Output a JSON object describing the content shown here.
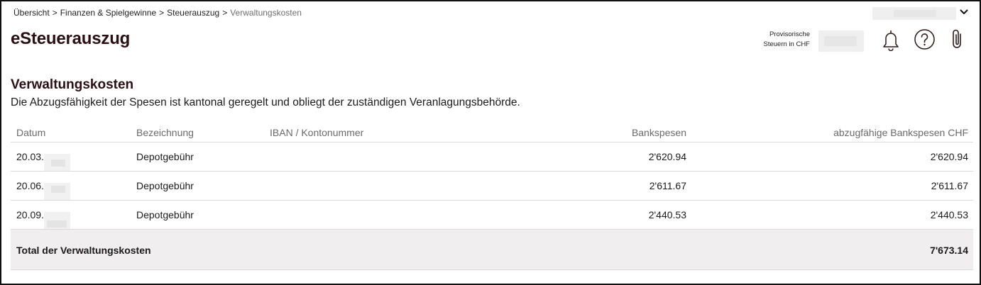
{
  "breadcrumb": {
    "items": [
      "Übersicht",
      "Finanzen & Spielgewinne",
      "Steuerauszug"
    ],
    "current": "Verwaltungskosten",
    "separator": ">"
  },
  "header": {
    "app_title": "eSteuerauszug",
    "provisional_label_line1": "Provisorische",
    "provisional_label_line2": "Steuern in CHF",
    "icons": [
      "bell-icon",
      "help-icon",
      "paperclip-icon",
      "chevron-down-icon"
    ]
  },
  "section": {
    "title": "Verwaltungskosten",
    "description": "Die Abzugsfähigkeit der Spesen ist kantonal geregelt und obliegt der zuständigen Veranlagungsbehörde."
  },
  "table": {
    "columns": {
      "date": "Datum",
      "description": "Bezeichnung",
      "iban": "IBAN / Kontonummer",
      "bank_fees": "Bankspesen",
      "deductible": "abzugfähige Bankspesen CHF"
    },
    "rows": [
      {
        "date": "20.03.",
        "description": "Depotgebühr",
        "iban": "",
        "bank_fees": "2'620.94",
        "deductible": "2'620.94"
      },
      {
        "date": "20.06.",
        "description": "Depotgebühr",
        "iban": "",
        "bank_fees": "2'611.67",
        "deductible": "2'611.67"
      },
      {
        "date": "20.09.",
        "description": "Depotgebühr",
        "iban": "",
        "bank_fees": "2'440.53",
        "deductible": "2'440.53"
      }
    ],
    "total": {
      "label": "Total der Verwaltungskosten",
      "value": "7'673.14"
    }
  },
  "colors": {
    "title": "#2a1015",
    "muted_text": "#6a6a6a",
    "total_row_bg": "#f0eeee",
    "divider": "#d9d9d9"
  }
}
